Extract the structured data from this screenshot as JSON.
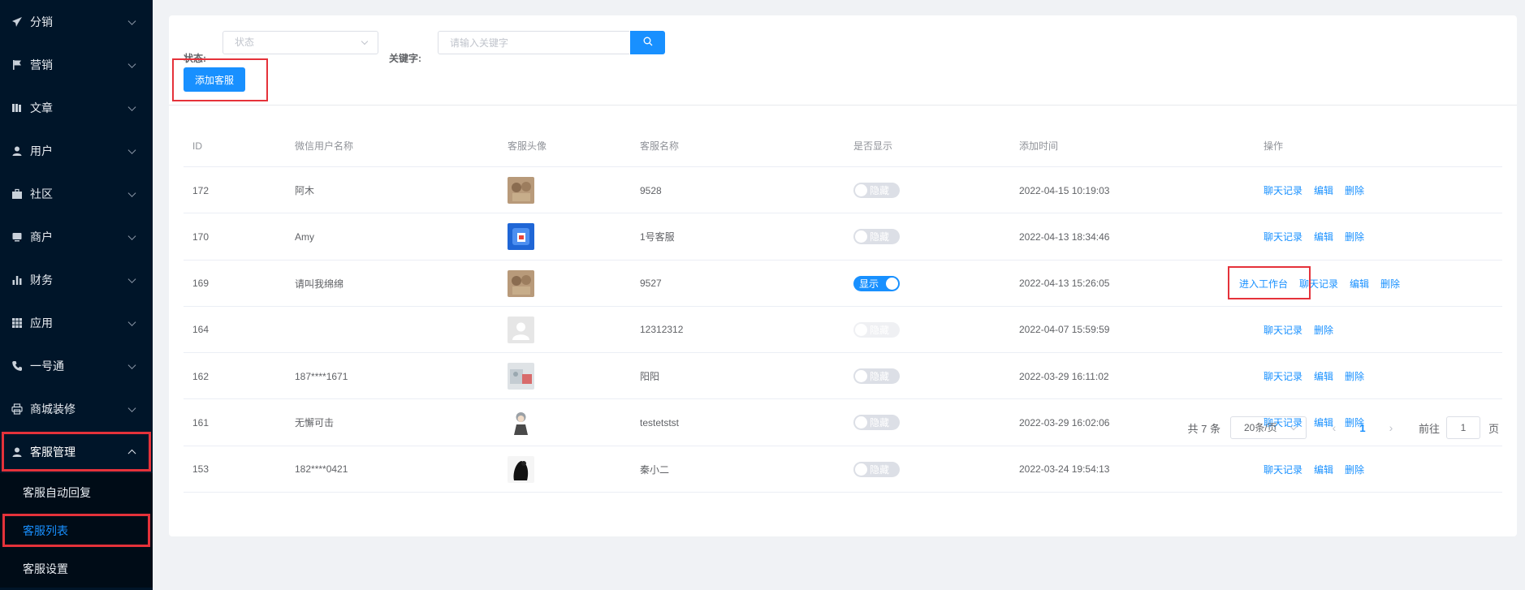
{
  "sidebar": {
    "menu": [
      {
        "label": "分销",
        "icon": "paper-plane-icon"
      },
      {
        "label": "营销",
        "icon": "flag-icon"
      },
      {
        "label": "文章",
        "icon": "book-icon"
      },
      {
        "label": "用户",
        "icon": "user-icon"
      },
      {
        "label": "社区",
        "icon": "briefcase-icon"
      },
      {
        "label": "商户",
        "icon": "shop-icon"
      },
      {
        "label": "财务",
        "icon": "bar-chart-icon"
      },
      {
        "label": "应用",
        "icon": "grid-icon"
      },
      {
        "label": "一号通",
        "icon": "phone-icon"
      },
      {
        "label": "商城装修",
        "icon": "printer-icon"
      },
      {
        "label": "客服管理",
        "icon": "user-icon"
      }
    ],
    "submenu": [
      {
        "label": "客服自动回复"
      },
      {
        "label": "客服列表"
      },
      {
        "label": "客服设置"
      }
    ]
  },
  "filter": {
    "status_label": "状态:",
    "status_placeholder": "状态",
    "keyword_label": "关键字:",
    "keyword_placeholder": "请输入关键字",
    "add_button": "添加客服"
  },
  "table": {
    "headers": {
      "id": "ID",
      "wx_name": "微信用户名称",
      "avatar": "客服头像",
      "name": "客服名称",
      "show": "是否显示",
      "time": "添加时间",
      "op": "操作"
    },
    "rows": [
      {
        "id": "172",
        "wx_name": "阿木",
        "name": "9528",
        "show": "隐藏",
        "time": "2022-04-15 10:19:03"
      },
      {
        "id": "170",
        "wx_name": "Amy",
        "name": "1号客服",
        "show": "隐藏",
        "time": "2022-04-13 18:34:46"
      },
      {
        "id": "169",
        "wx_name": "请叫我绵绵",
        "name": "9527",
        "show": "显示",
        "time": "2022-04-13 15:26:05"
      },
      {
        "id": "164",
        "wx_name": "",
        "name": "12312312",
        "show": "隐藏",
        "time": "2022-04-07 15:59:59"
      },
      {
        "id": "162",
        "wx_name": "187****1671",
        "name": "阳阳",
        "show": "隐藏",
        "time": "2022-03-29 16:11:02"
      },
      {
        "id": "161",
        "wx_name": "无懈可击",
        "name": "testetstst",
        "show": "隐藏",
        "time": "2022-03-29 16:02:06"
      },
      {
        "id": "153",
        "wx_name": "182****0421",
        "name": "秦小二",
        "show": "隐藏",
        "time": "2022-03-24 19:54:13"
      }
    ],
    "ops": {
      "workbench": "进入工作台",
      "chat_record": "聊天记录",
      "edit": "编辑",
      "delete": "删除"
    }
  },
  "pagination": {
    "total": "共 7 条",
    "page_size": "20条/页",
    "prev": "‹",
    "current": "1",
    "next": "›",
    "goto_label": "前往",
    "goto_value": "1",
    "page_label": "页"
  },
  "colors": {
    "primary": "#1890ff",
    "sidebar_bg": "#001529",
    "highlight_red": "#e5323a"
  }
}
